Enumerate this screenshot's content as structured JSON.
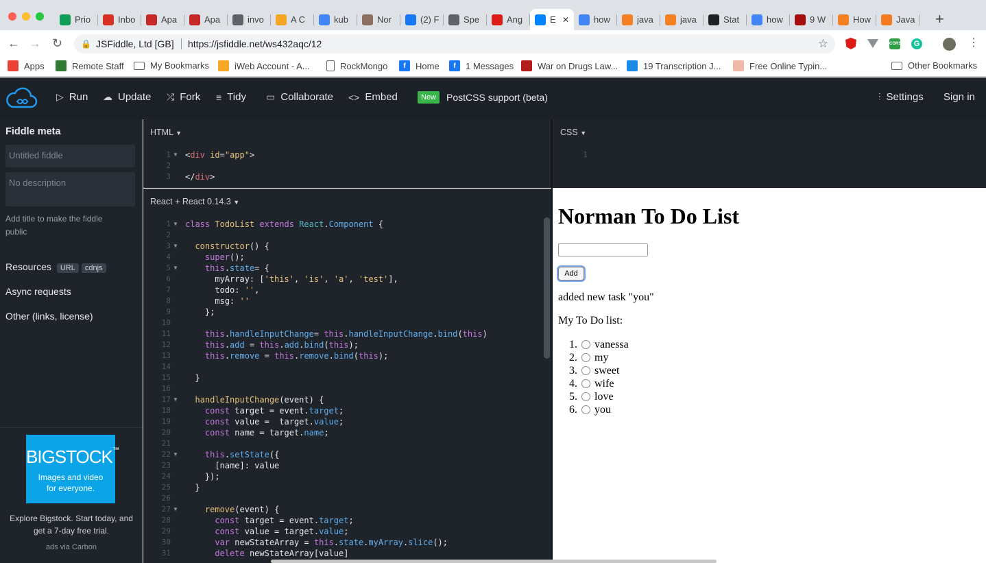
{
  "browser": {
    "tabs": [
      {
        "label": "Prio",
        "icon": "sheets-icon",
        "color": "#0f9d58"
      },
      {
        "label": "Inbo",
        "icon": "gmail-icon",
        "color": "#d93025"
      },
      {
        "label": "Apa",
        "icon": "apache-icon",
        "color": "#c62828"
      },
      {
        "label": "Apa",
        "icon": "apache-icon",
        "color": "#c62828"
      },
      {
        "label": "invo",
        "icon": "document-icon",
        "color": "#5f6368"
      },
      {
        "label": "A C",
        "icon": "asterisk-icon",
        "color": "#f5a623"
      },
      {
        "label": "kub",
        "icon": "google-icon",
        "color": "#4285f4"
      },
      {
        "label": "Nor",
        "icon": "avatar-icon",
        "color": "#8d6e63"
      },
      {
        "label": "(2) F",
        "icon": "facebook-icon",
        "color": "#1877f2"
      },
      {
        "label": "Spe",
        "icon": "speedometer-icon",
        "color": "#5f6368"
      },
      {
        "label": "Ang",
        "icon": "angular-icon",
        "color": "#dd1b16"
      },
      {
        "label": "E",
        "icon": "jsfiddle-icon",
        "color": "#0084ff",
        "active": true
      },
      {
        "label": "how",
        "icon": "google-icon",
        "color": "#4285f4"
      },
      {
        "label": "java",
        "icon": "stackoverflow-icon",
        "color": "#f48024"
      },
      {
        "label": "java",
        "icon": "stackoverflow-icon",
        "color": "#f48024"
      },
      {
        "label": "Stat",
        "icon": "codepen-icon",
        "color": "#202124"
      },
      {
        "label": "how",
        "icon": "google-icon",
        "color": "#4285f4"
      },
      {
        "label": "9 W",
        "icon": "heart-icon",
        "color": "#a50e0e"
      },
      {
        "label": "How",
        "icon": "stackoverflow-icon",
        "color": "#f48024"
      },
      {
        "label": "Java",
        "icon": "ha-icon",
        "color": "#f47b20"
      }
    ],
    "address": {
      "site_name": "JSFiddle, Ltd [GB]",
      "url": "https://jsfiddle.net/ws432aqc/12"
    },
    "bookmarks": [
      {
        "label": "Apps",
        "icon": "apps-grid-icon"
      },
      {
        "label": "Remote Staff",
        "icon": "remote-staff-icon"
      },
      {
        "label": "My Bookmarks",
        "icon": "folder-icon"
      },
      {
        "label": "iWeb Account - A...",
        "icon": "iweb-icon"
      },
      {
        "label": "RockMongo",
        "icon": "document-icon"
      },
      {
        "label": "Home",
        "icon": "facebook-icon"
      },
      {
        "label": "1 Messages",
        "icon": "facebook-icon"
      },
      {
        "label": "War on Drugs Law...",
        "icon": "us-icon"
      },
      {
        "label": "19 Transcription J...",
        "icon": "transcription-icon"
      },
      {
        "label": "Free Online Typin...",
        "icon": "typing-icon"
      },
      {
        "label": "Other Bookmarks",
        "icon": "folder-icon"
      }
    ]
  },
  "header": {
    "run": "Run",
    "update": "Update",
    "fork": "Fork",
    "tidy": "Tidy",
    "collaborate": "Collaborate",
    "embed": "Embed",
    "new_badge": "New",
    "announcement": "PostCSS support (beta)",
    "settings": "Settings",
    "sign_in": "Sign in"
  },
  "sidebar": {
    "title": "Fiddle meta",
    "title_placeholder": "Untitled fiddle",
    "description_placeholder": "No description",
    "hint": "Add title to make the fiddle public",
    "resources": "Resources",
    "resources_chips": [
      "URL",
      "cdnjs"
    ],
    "async": "Async requests",
    "other": "Other (links, license)",
    "ad": {
      "brand": "BIGSTOCK",
      "brand_mark": "™",
      "tagline": "Images and video for everyone.",
      "text": "Explore Bigstock. Start today, and get a 7-day free trial.",
      "via": "ads via Carbon"
    }
  },
  "panels": {
    "html_title": "HTML",
    "css_title": "CSS",
    "js_title": "React + React 0.14.3",
    "html_lines": [
      "<div id=\"app\">",
      "",
      "</div>"
    ],
    "css_lines": [
      ""
    ],
    "js_lines": [
      "class TodoList extends React.Component {",
      "",
      "  constructor() {",
      "    super();",
      "    this.state= {",
      "      myArray: ['this', 'is', 'a', 'test'],",
      "      todo: '',",
      "      msg: ''",
      "    };",
      "",
      "    this.handleInputChange= this.handleInputChange.bind(this)",
      "    this.add = this.add.bind(this);",
      "    this.remove = this.remove.bind(this);",
      "",
      "  }",
      "",
      "  handleInputChange(event) {",
      "    const target = event.target;",
      "    const value =  target.value;",
      "    const name = target.name;",
      "",
      "    this.setState({",
      "      [name]: value",
      "    });",
      "  }",
      "",
      "    remove(event) {",
      "      const target = event.target;",
      "      const value = target.value;",
      "      var newStateArray = this.state.myArray.slice();",
      "      delete newStateArray[value]"
    ]
  },
  "result": {
    "heading": "Norman To Do List",
    "input_value": "",
    "add_button": "Add",
    "message": "added new task \"you\"",
    "list_label": "My To Do list:",
    "items": [
      "vanessa",
      "my",
      "sweet",
      "wife",
      "love",
      "you"
    ]
  }
}
